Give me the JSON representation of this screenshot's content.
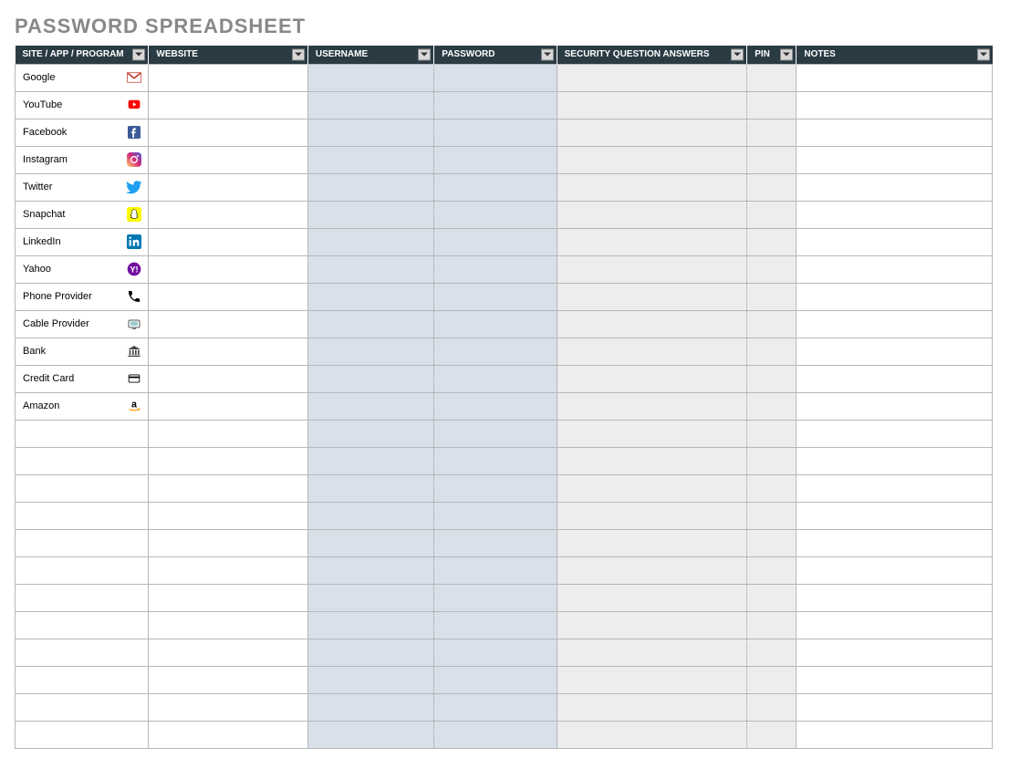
{
  "title": "PASSWORD SPREADSHEET",
  "columns": [
    {
      "label": "SITE / APP / PROGRAM",
      "key": "site"
    },
    {
      "label": "WEBSITE",
      "key": "website"
    },
    {
      "label": "USERNAME",
      "key": "username"
    },
    {
      "label": "PASSWORD",
      "key": "password"
    },
    {
      "label": "SECURITY QUESTION ANSWERS",
      "key": "security"
    },
    {
      "label": "PIN",
      "key": "pin"
    },
    {
      "label": "NOTES",
      "key": "notes"
    }
  ],
  "rows": [
    {
      "site": "Google",
      "icon": "gmail",
      "website": "",
      "username": "",
      "password": "",
      "security": "",
      "pin": "",
      "notes": ""
    },
    {
      "site": "YouTube",
      "icon": "youtube",
      "website": "",
      "username": "",
      "password": "",
      "security": "",
      "pin": "",
      "notes": ""
    },
    {
      "site": "Facebook",
      "icon": "facebook",
      "website": "",
      "username": "",
      "password": "",
      "security": "",
      "pin": "",
      "notes": ""
    },
    {
      "site": "Instagram",
      "icon": "instagram",
      "website": "",
      "username": "",
      "password": "",
      "security": "",
      "pin": "",
      "notes": ""
    },
    {
      "site": "Twitter",
      "icon": "twitter",
      "website": "",
      "username": "",
      "password": "",
      "security": "",
      "pin": "",
      "notes": ""
    },
    {
      "site": "Snapchat",
      "icon": "snapchat",
      "website": "",
      "username": "",
      "password": "",
      "security": "",
      "pin": "",
      "notes": ""
    },
    {
      "site": "LinkedIn",
      "icon": "linkedin",
      "website": "",
      "username": "",
      "password": "",
      "security": "",
      "pin": "",
      "notes": ""
    },
    {
      "site": "Yahoo",
      "icon": "yahoo",
      "website": "",
      "username": "",
      "password": "",
      "security": "",
      "pin": "",
      "notes": ""
    },
    {
      "site": "Phone Provider",
      "icon": "phone",
      "website": "",
      "username": "",
      "password": "",
      "security": "",
      "pin": "",
      "notes": ""
    },
    {
      "site": "Cable Provider",
      "icon": "tv",
      "website": "",
      "username": "",
      "password": "",
      "security": "",
      "pin": "",
      "notes": ""
    },
    {
      "site": "Bank",
      "icon": "bank",
      "website": "",
      "username": "",
      "password": "",
      "security": "",
      "pin": "",
      "notes": ""
    },
    {
      "site": "Credit Card",
      "icon": "card",
      "website": "",
      "username": "",
      "password": "",
      "security": "",
      "pin": "",
      "notes": ""
    },
    {
      "site": "Amazon",
      "icon": "amazon",
      "website": "",
      "username": "",
      "password": "",
      "security": "",
      "pin": "",
      "notes": ""
    },
    {
      "site": "",
      "icon": "",
      "website": "",
      "username": "",
      "password": "",
      "security": "",
      "pin": "",
      "notes": ""
    },
    {
      "site": "",
      "icon": "",
      "website": "",
      "username": "",
      "password": "",
      "security": "",
      "pin": "",
      "notes": ""
    },
    {
      "site": "",
      "icon": "",
      "website": "",
      "username": "",
      "password": "",
      "security": "",
      "pin": "",
      "notes": ""
    },
    {
      "site": "",
      "icon": "",
      "website": "",
      "username": "",
      "password": "",
      "security": "",
      "pin": "",
      "notes": ""
    },
    {
      "site": "",
      "icon": "",
      "website": "",
      "username": "",
      "password": "",
      "security": "",
      "pin": "",
      "notes": ""
    },
    {
      "site": "",
      "icon": "",
      "website": "",
      "username": "",
      "password": "",
      "security": "",
      "pin": "",
      "notes": ""
    },
    {
      "site": "",
      "icon": "",
      "website": "",
      "username": "",
      "password": "",
      "security": "",
      "pin": "",
      "notes": ""
    },
    {
      "site": "",
      "icon": "",
      "website": "",
      "username": "",
      "password": "",
      "security": "",
      "pin": "",
      "notes": ""
    },
    {
      "site": "",
      "icon": "",
      "website": "",
      "username": "",
      "password": "",
      "security": "",
      "pin": "",
      "notes": ""
    },
    {
      "site": "",
      "icon": "",
      "website": "",
      "username": "",
      "password": "",
      "security": "",
      "pin": "",
      "notes": ""
    },
    {
      "site": "",
      "icon": "",
      "website": "",
      "username": "",
      "password": "",
      "security": "",
      "pin": "",
      "notes": ""
    },
    {
      "site": "",
      "icon": "",
      "website": "",
      "username": "",
      "password": "",
      "security": "",
      "pin": "",
      "notes": ""
    }
  ]
}
